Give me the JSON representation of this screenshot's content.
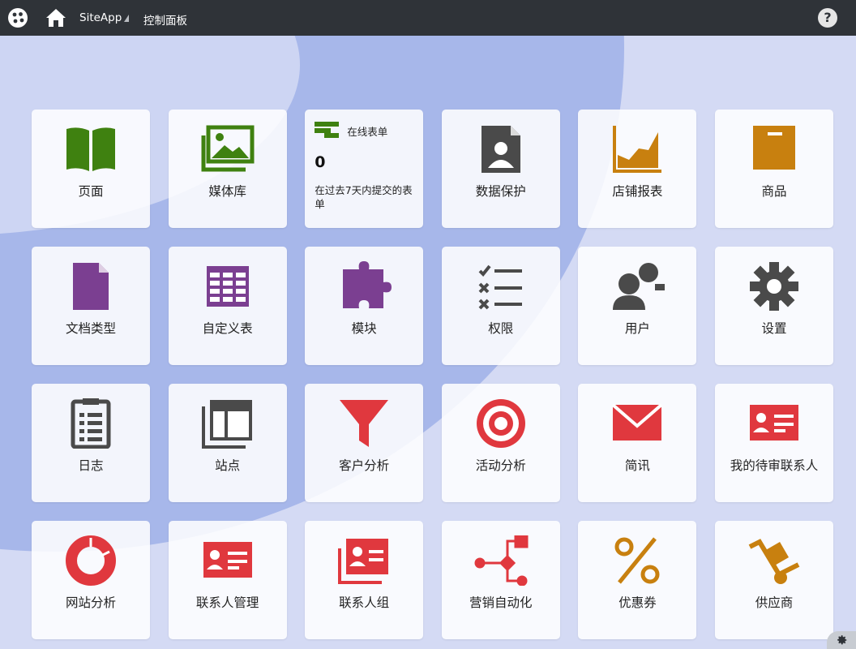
{
  "topbar": {
    "logo_icon": "sitecore-logo-icon",
    "home_icon": "home-icon",
    "site_label": "SiteApp",
    "breadcrumb": "控制面板",
    "help_label": "?"
  },
  "tiles": [
    {
      "label": "页面",
      "icon": "book-icon",
      "color": "#3f8110"
    },
    {
      "label": "媒体库",
      "icon": "media-images-icon",
      "color": "#3f8110"
    },
    {
      "title": "在线表单",
      "count": "0",
      "description": "在过去7天内提交的表单",
      "icon": "forms-icon",
      "color": "#3f8110"
    },
    {
      "label": "数据保护",
      "icon": "data-protection-icon",
      "color": "#4a4a4a"
    },
    {
      "label": "店铺报表",
      "icon": "area-chart-icon",
      "color": "#c8800f"
    },
    {
      "label": "商品",
      "icon": "product-box-icon",
      "color": "#c8800f"
    },
    {
      "label": "文档类型",
      "icon": "document-icon",
      "color": "#7b3f91"
    },
    {
      "label": "自定义表",
      "icon": "table-grid-icon",
      "color": "#7b3f91"
    },
    {
      "label": "模块",
      "icon": "puzzle-icon",
      "color": "#7b3f91"
    },
    {
      "label": "权限",
      "icon": "checklist-icon",
      "color": "#4a4a4a"
    },
    {
      "label": "用户",
      "icon": "users-icon",
      "color": "#4a4a4a"
    },
    {
      "label": "设置",
      "icon": "gear-icon",
      "color": "#4a4a4a"
    },
    {
      "label": "日志",
      "icon": "clipboard-log-icon",
      "color": "#4a4a4a"
    },
    {
      "label": "站点",
      "icon": "site-layout-icon",
      "color": "#4a4a4a"
    },
    {
      "label": "客户分析",
      "icon": "funnel-icon",
      "color": "#e0383e"
    },
    {
      "label": "活动分析",
      "icon": "target-icon",
      "color": "#e0383e"
    },
    {
      "label": "简讯",
      "icon": "envelope-icon",
      "color": "#e0383e"
    },
    {
      "label": "我的待审联系人",
      "icon": "contact-card-icon",
      "color": "#e0383e"
    },
    {
      "label": "网站分析",
      "icon": "donut-chart-icon",
      "color": "#e0383e"
    },
    {
      "label": "联系人管理",
      "icon": "contact-card-icon",
      "color": "#e0383e"
    },
    {
      "label": "联系人组",
      "icon": "contact-cards-stack-icon",
      "color": "#e0383e"
    },
    {
      "label": "营销自动化",
      "icon": "flow-diagram-icon",
      "color": "#e0383e"
    },
    {
      "label": "优惠券",
      "icon": "percent-icon",
      "color": "#c8800f"
    },
    {
      "label": "供应商",
      "icon": "hand-truck-icon",
      "color": "#c8800f"
    }
  ],
  "footer": {
    "settings_icon": "gear-icon"
  }
}
